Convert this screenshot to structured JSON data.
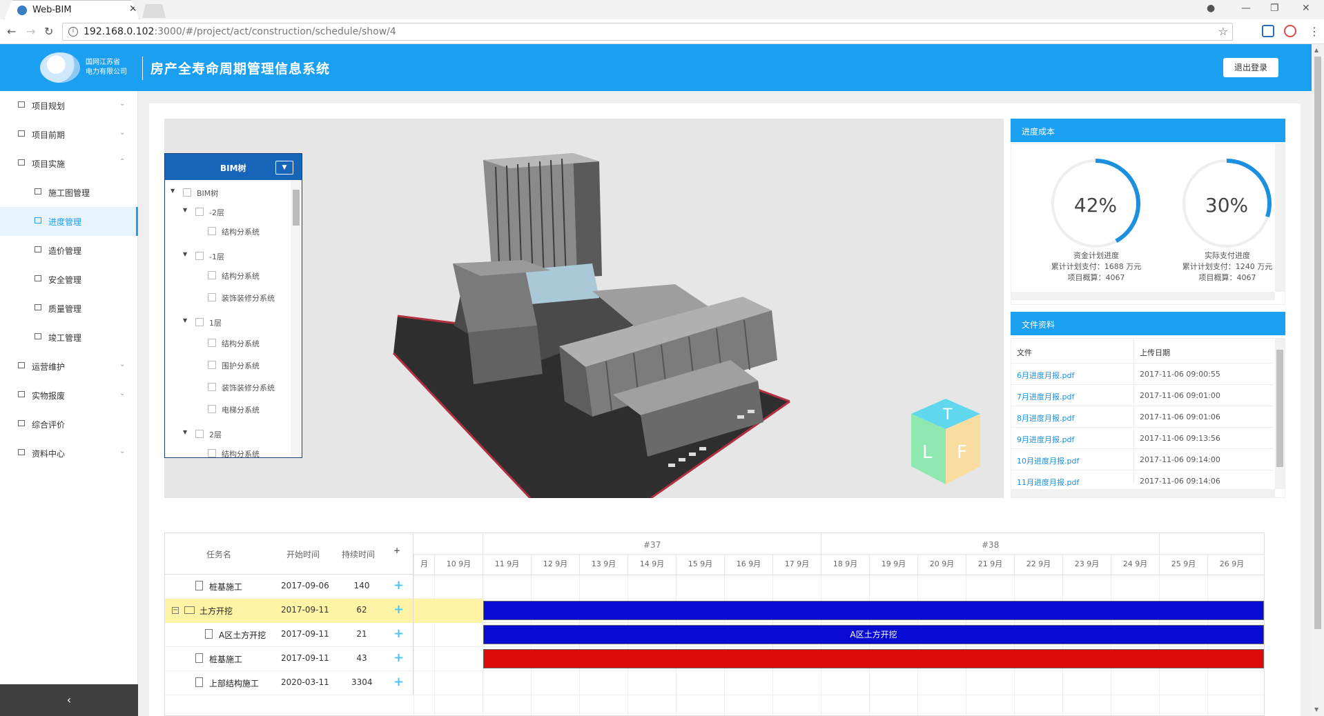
{
  "browser": {
    "tab_title": "Web-BIM",
    "url_host": "192.168.0.102",
    "url_rest": ":3000/#/project/act/construction/schedule/show/4"
  },
  "header": {
    "logo_line1": "国网江苏省",
    "logo_line2": "电力有限公司",
    "system_title": "房产全寿命周期管理信息系统",
    "logout_label": "退出登录"
  },
  "sidebar": {
    "items": [
      {
        "label": "项目规划",
        "chevron": "⌄"
      },
      {
        "label": "项目前期",
        "chevron": "⌄"
      },
      {
        "label": "项目实施",
        "chevron": "⌃"
      },
      {
        "label": "施工图管理",
        "chevron": ""
      },
      {
        "label": "进度管理",
        "chevron": ""
      },
      {
        "label": "造价管理",
        "chevron": ""
      },
      {
        "label": "安全管理",
        "chevron": ""
      },
      {
        "label": "质量管理",
        "chevron": ""
      },
      {
        "label": "竣工管理",
        "chevron": ""
      },
      {
        "label": "运营维护",
        "chevron": "⌄"
      },
      {
        "label": "实物报废",
        "chevron": "⌄"
      },
      {
        "label": "综合评价",
        "chevron": ""
      },
      {
        "label": "资料中心",
        "chevron": "⌄"
      }
    ],
    "collapse_label": "‹"
  },
  "bim_tree": {
    "title": "BIM树",
    "toggle": "▼",
    "nodes": [
      {
        "label": "BIM树",
        "level": 0,
        "arrow": "▼"
      },
      {
        "label": "-2层",
        "level": 1,
        "arrow": "▼"
      },
      {
        "label": "结构分系统",
        "level": 2,
        "arrow": ""
      },
      {
        "label": "-1层",
        "level": 1,
        "arrow": "▼"
      },
      {
        "label": "结构分系统",
        "level": 2,
        "arrow": ""
      },
      {
        "label": "装饰装修分系统",
        "level": 2,
        "arrow": ""
      },
      {
        "label": "1层",
        "level": 1,
        "arrow": "▼"
      },
      {
        "label": "结构分系统",
        "level": 2,
        "arrow": ""
      },
      {
        "label": "围护分系统",
        "level": 2,
        "arrow": ""
      },
      {
        "label": "装饰装修分系统",
        "level": 2,
        "arrow": ""
      },
      {
        "label": "电梯分系统",
        "level": 2,
        "arrow": ""
      },
      {
        "label": "2层",
        "level": 1,
        "arrow": "▼"
      },
      {
        "label": "结构分系统",
        "level": 2,
        "arrow": ""
      }
    ]
  },
  "nav_cube": {
    "top": "T",
    "left": "L",
    "front": "F"
  },
  "progress_cost": {
    "title": "进度成本",
    "gauges": [
      {
        "value_text": "42%",
        "value": 0.42,
        "label": "资金计划进度",
        "line2": "累计计划支付：1688 万元",
        "line3": "项目概算：4067"
      },
      {
        "value_text": "30%",
        "value": 0.3,
        "label": "实际支付进度",
        "line2": "累计计划支付：1240 万元",
        "line3": "项目概算：4067"
      }
    ]
  },
  "files": {
    "title": "文件资料",
    "col_file": "文件",
    "col_date": "上传日期",
    "rows": [
      {
        "name": "6月进度月报.pdf",
        "date": "2017-11-06 09:00:55"
      },
      {
        "name": "7月进度月报.pdf",
        "date": "2017-11-06 09:01:00"
      },
      {
        "name": "8月进度月报.pdf",
        "date": "2017-11-06 09:01:06"
      },
      {
        "name": "9月进度月报.pdf",
        "date": "2017-11-06 09:13:56"
      },
      {
        "name": "10月进度月报.pdf",
        "date": "2017-11-06 09:14:00"
      },
      {
        "name": "11月进度月报.pdf",
        "date": "2017-11-06 09:14:06"
      }
    ]
  },
  "gantt": {
    "col_task": "任务名",
    "col_start": "开始时间",
    "col_duration": "持续时间",
    "add_symbol": "+",
    "weeks": [
      "#37",
      "#38"
    ],
    "days": [
      "月",
      "10 9月",
      "11 9月",
      "12 9月",
      "13 9月",
      "14 9月",
      "15 9月",
      "16 9月",
      "17 9月",
      "18 9月",
      "19 9月",
      "20 9月",
      "21 9月",
      "22 9月",
      "23 9月",
      "24 9月",
      "25 9月",
      "26 9月"
    ],
    "tasks": [
      {
        "name": "桩基施工",
        "start": "2017-09-06",
        "duration": "140",
        "indent": 1,
        "type": "doc",
        "bar": null,
        "bar_label": ""
      },
      {
        "name": "土方开挖",
        "start": "2017-09-11",
        "duration": "62",
        "indent": 0,
        "type": "folder",
        "bar": "#0a0ad6",
        "bar_label": ""
      },
      {
        "name": "A区土方开挖",
        "start": "2017-09-11",
        "duration": "21",
        "indent": 2,
        "type": "doc",
        "bar": "#0a0ad6",
        "bar_label": "A区土方开挖"
      },
      {
        "name": "桩基施工",
        "start": "2017-09-11",
        "duration": "43",
        "indent": 1,
        "type": "doc",
        "bar": "#dd0a0a",
        "bar_label": ""
      },
      {
        "name": "上部结构施工",
        "start": "2020-03-11",
        "duration": "3304",
        "indent": 1,
        "type": "doc",
        "bar": null,
        "bar_label": ""
      }
    ]
  },
  "colors": {
    "brand": "#1b9ff0",
    "tree_head": "#1765b8",
    "gauge_arc": "#1b8fe0",
    "highlight": "#fff3a6"
  }
}
